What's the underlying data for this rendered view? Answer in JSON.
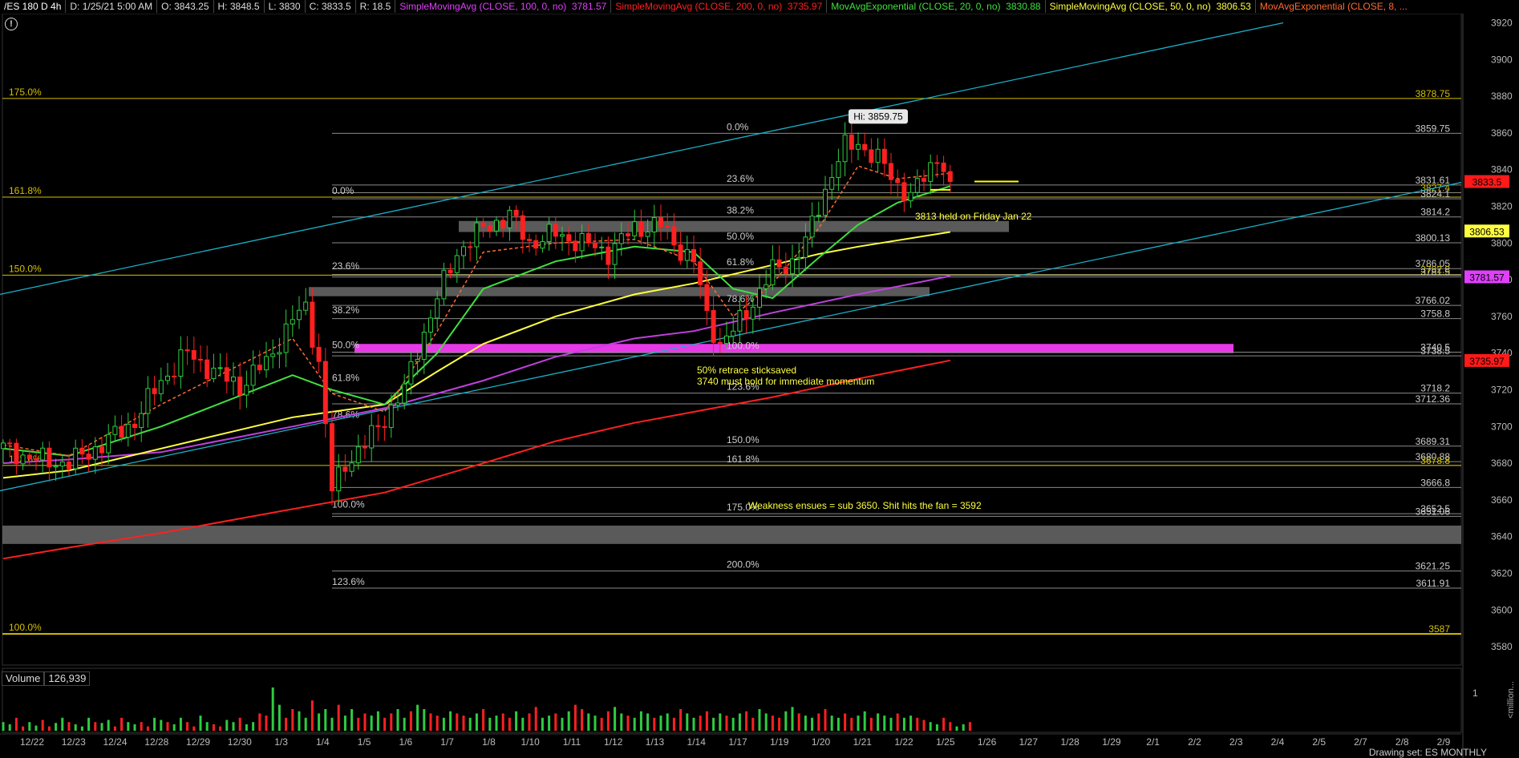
{
  "header": {
    "symbol": "/ES 180 D 4h",
    "bar_date": "D: 1/25/21 5:00 AM",
    "open": "O: 3843.25",
    "high": "H: 3848.5",
    "low": "L: 3830",
    "close": "C: 3833.5",
    "range": "R: 18.5",
    "studies": [
      {
        "label": "SimpleMovingAvg (CLOSE, 100, 0, no)",
        "value": "3781.57",
        "color": "#e040fb"
      },
      {
        "label": "SimpleMovingAvg (CLOSE, 200, 0, no)",
        "value": "3735.97",
        "color": "#ff2020"
      },
      {
        "label": "MovAvgExponential (CLOSE, 20, 0, no)",
        "value": "3830.88",
        "color": "#40e040"
      },
      {
        "label": "SimpleMovingAvg (CLOSE, 50, 0, no)",
        "value": "3806.53",
        "color": "#ffff40"
      },
      {
        "label": "MovAvgExponential (CLOSE, 8, ...",
        "value": "",
        "color": "#ff6a30"
      }
    ]
  },
  "info_icon": "info-icon",
  "volume_panel": {
    "label": "Volume",
    "value": "126,939",
    "axis_top": "1",
    "axis_unit": "<million..."
  },
  "footer_text": "Drawing set: ES MONTHLY",
  "chart_data": {
    "type": "candlestick",
    "y_axis": {
      "min": 3570,
      "max": 3925,
      "ticks": [
        3580,
        3600,
        3620,
        3640,
        3660,
        3680,
        3700,
        3720,
        3740,
        3760,
        3780,
        3800,
        3820,
        3840,
        3860,
        3880,
        3900,
        3920
      ]
    },
    "x_axis": {
      "tick_labels": [
        "12/22",
        "12/23",
        "12/24",
        "12/28",
        "12/29",
        "12/30",
        "1/3",
        "1/4",
        "1/5",
        "1/6",
        "1/7",
        "1/8",
        "1/10",
        "1/11",
        "1/12",
        "1/13",
        "1/14",
        "1/17",
        "1/19",
        "1/20",
        "1/21",
        "1/22",
        "1/25",
        "1/26",
        "1/27",
        "1/28",
        "1/29",
        "2/1",
        "2/2",
        "2/3",
        "2/4",
        "2/5",
        "2/7",
        "2/8",
        "2/9"
      ]
    },
    "last_price": 3833.5,
    "price_tags": [
      {
        "value": "3833.5",
        "bg": "#ff1a1a",
        "fg": "#000"
      },
      {
        "value": "3806.53",
        "bg": "#ffff40",
        "fg": "#000"
      },
      {
        "value": "3781.57",
        "bg": "#e040fb",
        "fg": "#000"
      },
      {
        "value": "3735.97",
        "bg": "#ff1a1a",
        "fg": "#000"
      }
    ],
    "level_labels": [
      "3878.75",
      "3859.75",
      "3831.61",
      "3827.4",
      "3824.1",
      "3814.2",
      "3800.13",
      "3786.05",
      "3782.8",
      "3781.5",
      "3766.02",
      "3758.8",
      "3740.5",
      "3738.5",
      "3718.2",
      "3712.36",
      "3689.31",
      "3680.88",
      "3678.8",
      "3666.8",
      "3652.5",
      "3651.06",
      "3621.25",
      "3611.91",
      "3587"
    ],
    "fib_labels_left": [
      "175.0%",
      "161.8%",
      "150.0%",
      "123.6%",
      "100.0%"
    ],
    "fib_labels_mid": [
      "0.0%",
      "23.6%",
      "38.2%",
      "50.0%",
      "61.8%",
      "78.6%",
      "100.0%",
      "123.6%"
    ],
    "fib_labels_right": [
      "0.0%",
      "23.6%",
      "38.2%",
      "50.0%",
      "61.8%",
      "78.6%",
      "100.0%",
      "123.6%",
      "150.0%",
      "161.8%",
      "175.0%",
      "200.0%"
    ],
    "high_label": "Hi: 3859.75",
    "annotations": [
      "3813 held on Friday Jan 22",
      "50% retrace sticksaved",
      "3740 must hold for immediate momentum",
      "Weakness ensues = sub 3650. Shit hits the fan = 3592"
    ],
    "series": [
      {
        "name": "SimpleMovingAvg (CLOSE, 100, 0, no)",
        "color": "#e040fb"
      },
      {
        "name": "SimpleMovingAvg (CLOSE, 200, 0, no)",
        "color": "#ff2020"
      },
      {
        "name": "MovAvgExponential (CLOSE, 20, 0, no)",
        "color": "#40e040"
      },
      {
        "name": "SimpleMovingAvg (CLOSE, 50, 0, no)",
        "color": "#ffff40"
      },
      {
        "name": "MovAvgExponential (CLOSE, 8, ...",
        "color": "#ff6a30"
      }
    ],
    "close_path": [
      [
        0,
        3688
      ],
      [
        5,
        3682
      ],
      [
        10,
        3680
      ],
      [
        15,
        3690
      ],
      [
        20,
        3703
      ],
      [
        24,
        3725
      ],
      [
        28,
        3740
      ],
      [
        32,
        3730
      ],
      [
        36,
        3722
      ],
      [
        40,
        3735
      ],
      [
        44,
        3758
      ],
      [
        46,
        3765
      ],
      [
        48,
        3735
      ],
      [
        50,
        3665
      ],
      [
        52,
        3680
      ],
      [
        55,
        3690
      ],
      [
        58,
        3705
      ],
      [
        61,
        3720
      ],
      [
        63,
        3742
      ],
      [
        66,
        3770
      ],
      [
        69,
        3795
      ],
      [
        73,
        3808
      ],
      [
        77,
        3815
      ],
      [
        80,
        3800
      ],
      [
        84,
        3805
      ],
      [
        88,
        3800
      ],
      [
        92,
        3795
      ],
      [
        96,
        3808
      ],
      [
        100,
        3810
      ],
      [
        102,
        3800
      ],
      [
        105,
        3790
      ],
      [
        107,
        3760
      ],
      [
        109,
        3745
      ],
      [
        111,
        3752
      ],
      [
        114,
        3768
      ],
      [
        117,
        3785
      ],
      [
        120,
        3790
      ],
      [
        122,
        3800
      ],
      [
        124,
        3820
      ],
      [
        126,
        3838
      ],
      [
        128,
        3852
      ],
      [
        130,
        3855
      ],
      [
        132,
        3848
      ],
      [
        134,
        3842
      ],
      [
        136,
        3832
      ],
      [
        138,
        3825
      ],
      [
        140,
        3836
      ],
      [
        142,
        3848
      ],
      [
        144,
        3834
      ]
    ],
    "ema8_path": [
      [
        0,
        3690
      ],
      [
        10,
        3684
      ],
      [
        24,
        3712
      ],
      [
        44,
        3748
      ],
      [
        50,
        3718
      ],
      [
        58,
        3708
      ],
      [
        66,
        3752
      ],
      [
        73,
        3795
      ],
      [
        84,
        3800
      ],
      [
        96,
        3802
      ],
      [
        105,
        3790
      ],
      [
        111,
        3760
      ],
      [
        117,
        3778
      ],
      [
        124,
        3808
      ],
      [
        130,
        3842
      ],
      [
        136,
        3835
      ],
      [
        144,
        3838
      ]
    ],
    "ema20_path": [
      [
        0,
        3688
      ],
      [
        10,
        3684
      ],
      [
        24,
        3700
      ],
      [
        44,
        3728
      ],
      [
        50,
        3720
      ],
      [
        58,
        3712
      ],
      [
        66,
        3740
      ],
      [
        73,
        3775
      ],
      [
        84,
        3790
      ],
      [
        96,
        3798
      ],
      [
        105,
        3795
      ],
      [
        111,
        3775
      ],
      [
        117,
        3770
      ],
      [
        124,
        3792
      ],
      [
        130,
        3810
      ],
      [
        136,
        3822
      ],
      [
        144,
        3831
      ]
    ],
    "sma50_path": [
      [
        0,
        3672
      ],
      [
        10,
        3676
      ],
      [
        24,
        3688
      ],
      [
        44,
        3705
      ],
      [
        58,
        3712
      ],
      [
        66,
        3730
      ],
      [
        73,
        3745
      ],
      [
        84,
        3760
      ],
      [
        96,
        3772
      ],
      [
        105,
        3778
      ],
      [
        117,
        3788
      ],
      [
        124,
        3794
      ],
      [
        130,
        3798
      ],
      [
        144,
        3806
      ]
    ],
    "sma100_path": [
      [
        0,
        3680
      ],
      [
        10,
        3682
      ],
      [
        24,
        3686
      ],
      [
        44,
        3700
      ],
      [
        58,
        3710
      ],
      [
        73,
        3725
      ],
      [
        84,
        3738
      ],
      [
        96,
        3748
      ],
      [
        105,
        3752
      ],
      [
        117,
        3762
      ],
      [
        130,
        3772
      ],
      [
        144,
        3782
      ]
    ],
    "sma200_path": [
      [
        0,
        3628
      ],
      [
        10,
        3634
      ],
      [
        24,
        3642
      ],
      [
        44,
        3655
      ],
      [
        58,
        3664
      ],
      [
        73,
        3680
      ],
      [
        84,
        3692
      ],
      [
        96,
        3702
      ],
      [
        105,
        3708
      ],
      [
        117,
        3716
      ],
      [
        130,
        3726
      ],
      [
        144,
        3736
      ]
    ],
    "volume": [
      0.2,
      0.15,
      0.3,
      0.1,
      0.2,
      0.12,
      0.25,
      0.1,
      0.18,
      0.3,
      0.2,
      0.15,
      0.1,
      0.3,
      0.2,
      0.18,
      0.25,
      0.1,
      0.3,
      0.2,
      0.15,
      0.2,
      0.1,
      0.3,
      0.25,
      0.2,
      0.15,
      0.3,
      0.2,
      0.1,
      0.35,
      0.2,
      0.15,
      0.1,
      0.25,
      0.2,
      0.3,
      0.15,
      0.2,
      0.4,
      0.35,
      1.0,
      0.6,
      0.3,
      0.5,
      0.45,
      0.3,
      0.7,
      0.4,
      0.5,
      0.3,
      0.6,
      0.35,
      0.5,
      0.3,
      0.4,
      0.35,
      0.45,
      0.3,
      0.4,
      0.5,
      0.3,
      0.45,
      0.6,
      0.5,
      0.4,
      0.35,
      0.3,
      0.45,
      0.4,
      0.35,
      0.3,
      0.4,
      0.5,
      0.3,
      0.35,
      0.4,
      0.3,
      0.45,
      0.3,
      0.4,
      0.55,
      0.3,
      0.35,
      0.4,
      0.3,
      0.45,
      0.6,
      0.5,
      0.4,
      0.35,
      0.3,
      0.45,
      0.55,
      0.4,
      0.35,
      0.3,
      0.45,
      0.4,
      0.3,
      0.35,
      0.4,
      0.3,
      0.5,
      0.4,
      0.3,
      0.35,
      0.45,
      0.3,
      0.4,
      0.35,
      0.3,
      0.4,
      0.45,
      0.3,
      0.5,
      0.4,
      0.35,
      0.3,
      0.45,
      0.55,
      0.4,
      0.35,
      0.3,
      0.4,
      0.5,
      0.35,
      0.3,
      0.4,
      0.3,
      0.35,
      0.45,
      0.3,
      0.4,
      0.35,
      0.3,
      0.4,
      0.3,
      0.35,
      0.3,
      0.25,
      0.2,
      0.15,
      0.3,
      0.2,
      0.1,
      0.15,
      0.2
    ]
  }
}
